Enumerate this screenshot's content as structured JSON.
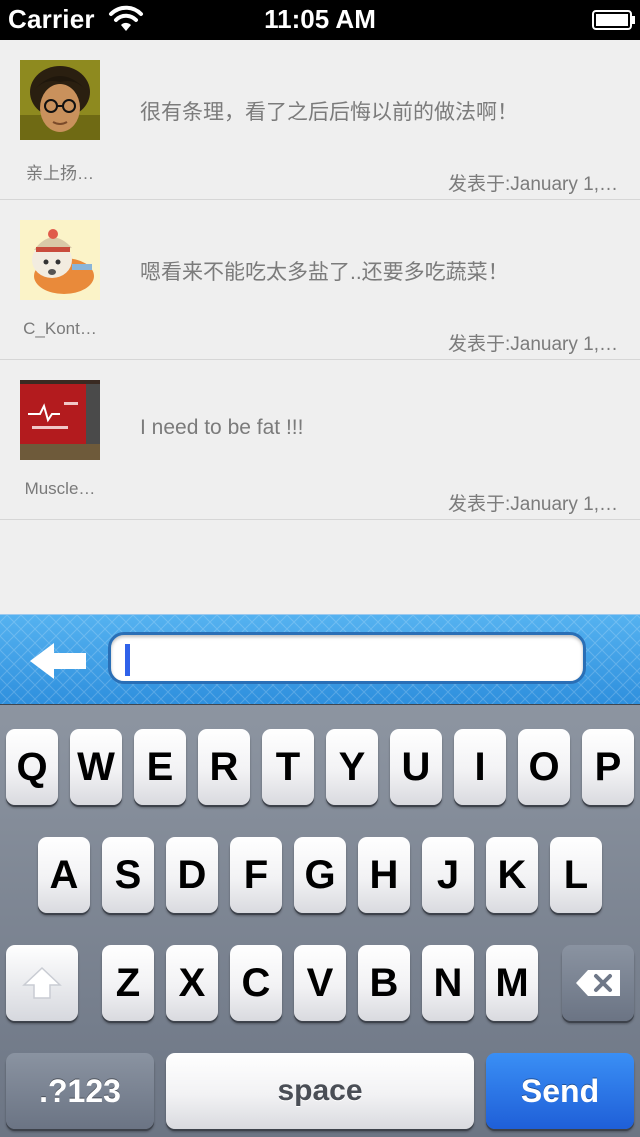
{
  "status_bar": {
    "carrier": "Carrier",
    "time": "11:05 AM",
    "wifi_icon": "wifi-icon",
    "battery_icon": "battery-icon"
  },
  "comments": [
    {
      "username": "亲上扬…",
      "text": "很有条理，看了之后后悔以前的做法啊！",
      "timestamp": "发表于:January 1,…",
      "avatar": "avatar-person-glasses"
    },
    {
      "username": "C_Kont…",
      "text": "嗯看来不能吃太多盐了..还要多吃蔬菜！",
      "timestamp": "发表于:January 1,…",
      "avatar": "avatar-cartoon-character"
    },
    {
      "username": "Muscle…",
      "text": "I need to be fat !!!",
      "timestamp": "发表于:January 1,…",
      "avatar": "avatar-screen-photo"
    }
  ],
  "input_bar": {
    "back_icon": "left-arrow-icon",
    "input_value": "",
    "accent_color": "#3d9fe8"
  },
  "keyboard": {
    "row1": [
      "Q",
      "W",
      "E",
      "R",
      "T",
      "Y",
      "U",
      "I",
      "O",
      "P"
    ],
    "row2": [
      "A",
      "S",
      "D",
      "F",
      "G",
      "H",
      "J",
      "K",
      "L"
    ],
    "row3": [
      "Z",
      "X",
      "C",
      "V",
      "B",
      "N",
      "M"
    ],
    "shift_icon": "shift-arrow-icon",
    "delete_icon": "backspace-icon",
    "numbers_label": ".?123",
    "space_label": "space",
    "send_label": "Send",
    "send_color": "#2a72e6"
  }
}
